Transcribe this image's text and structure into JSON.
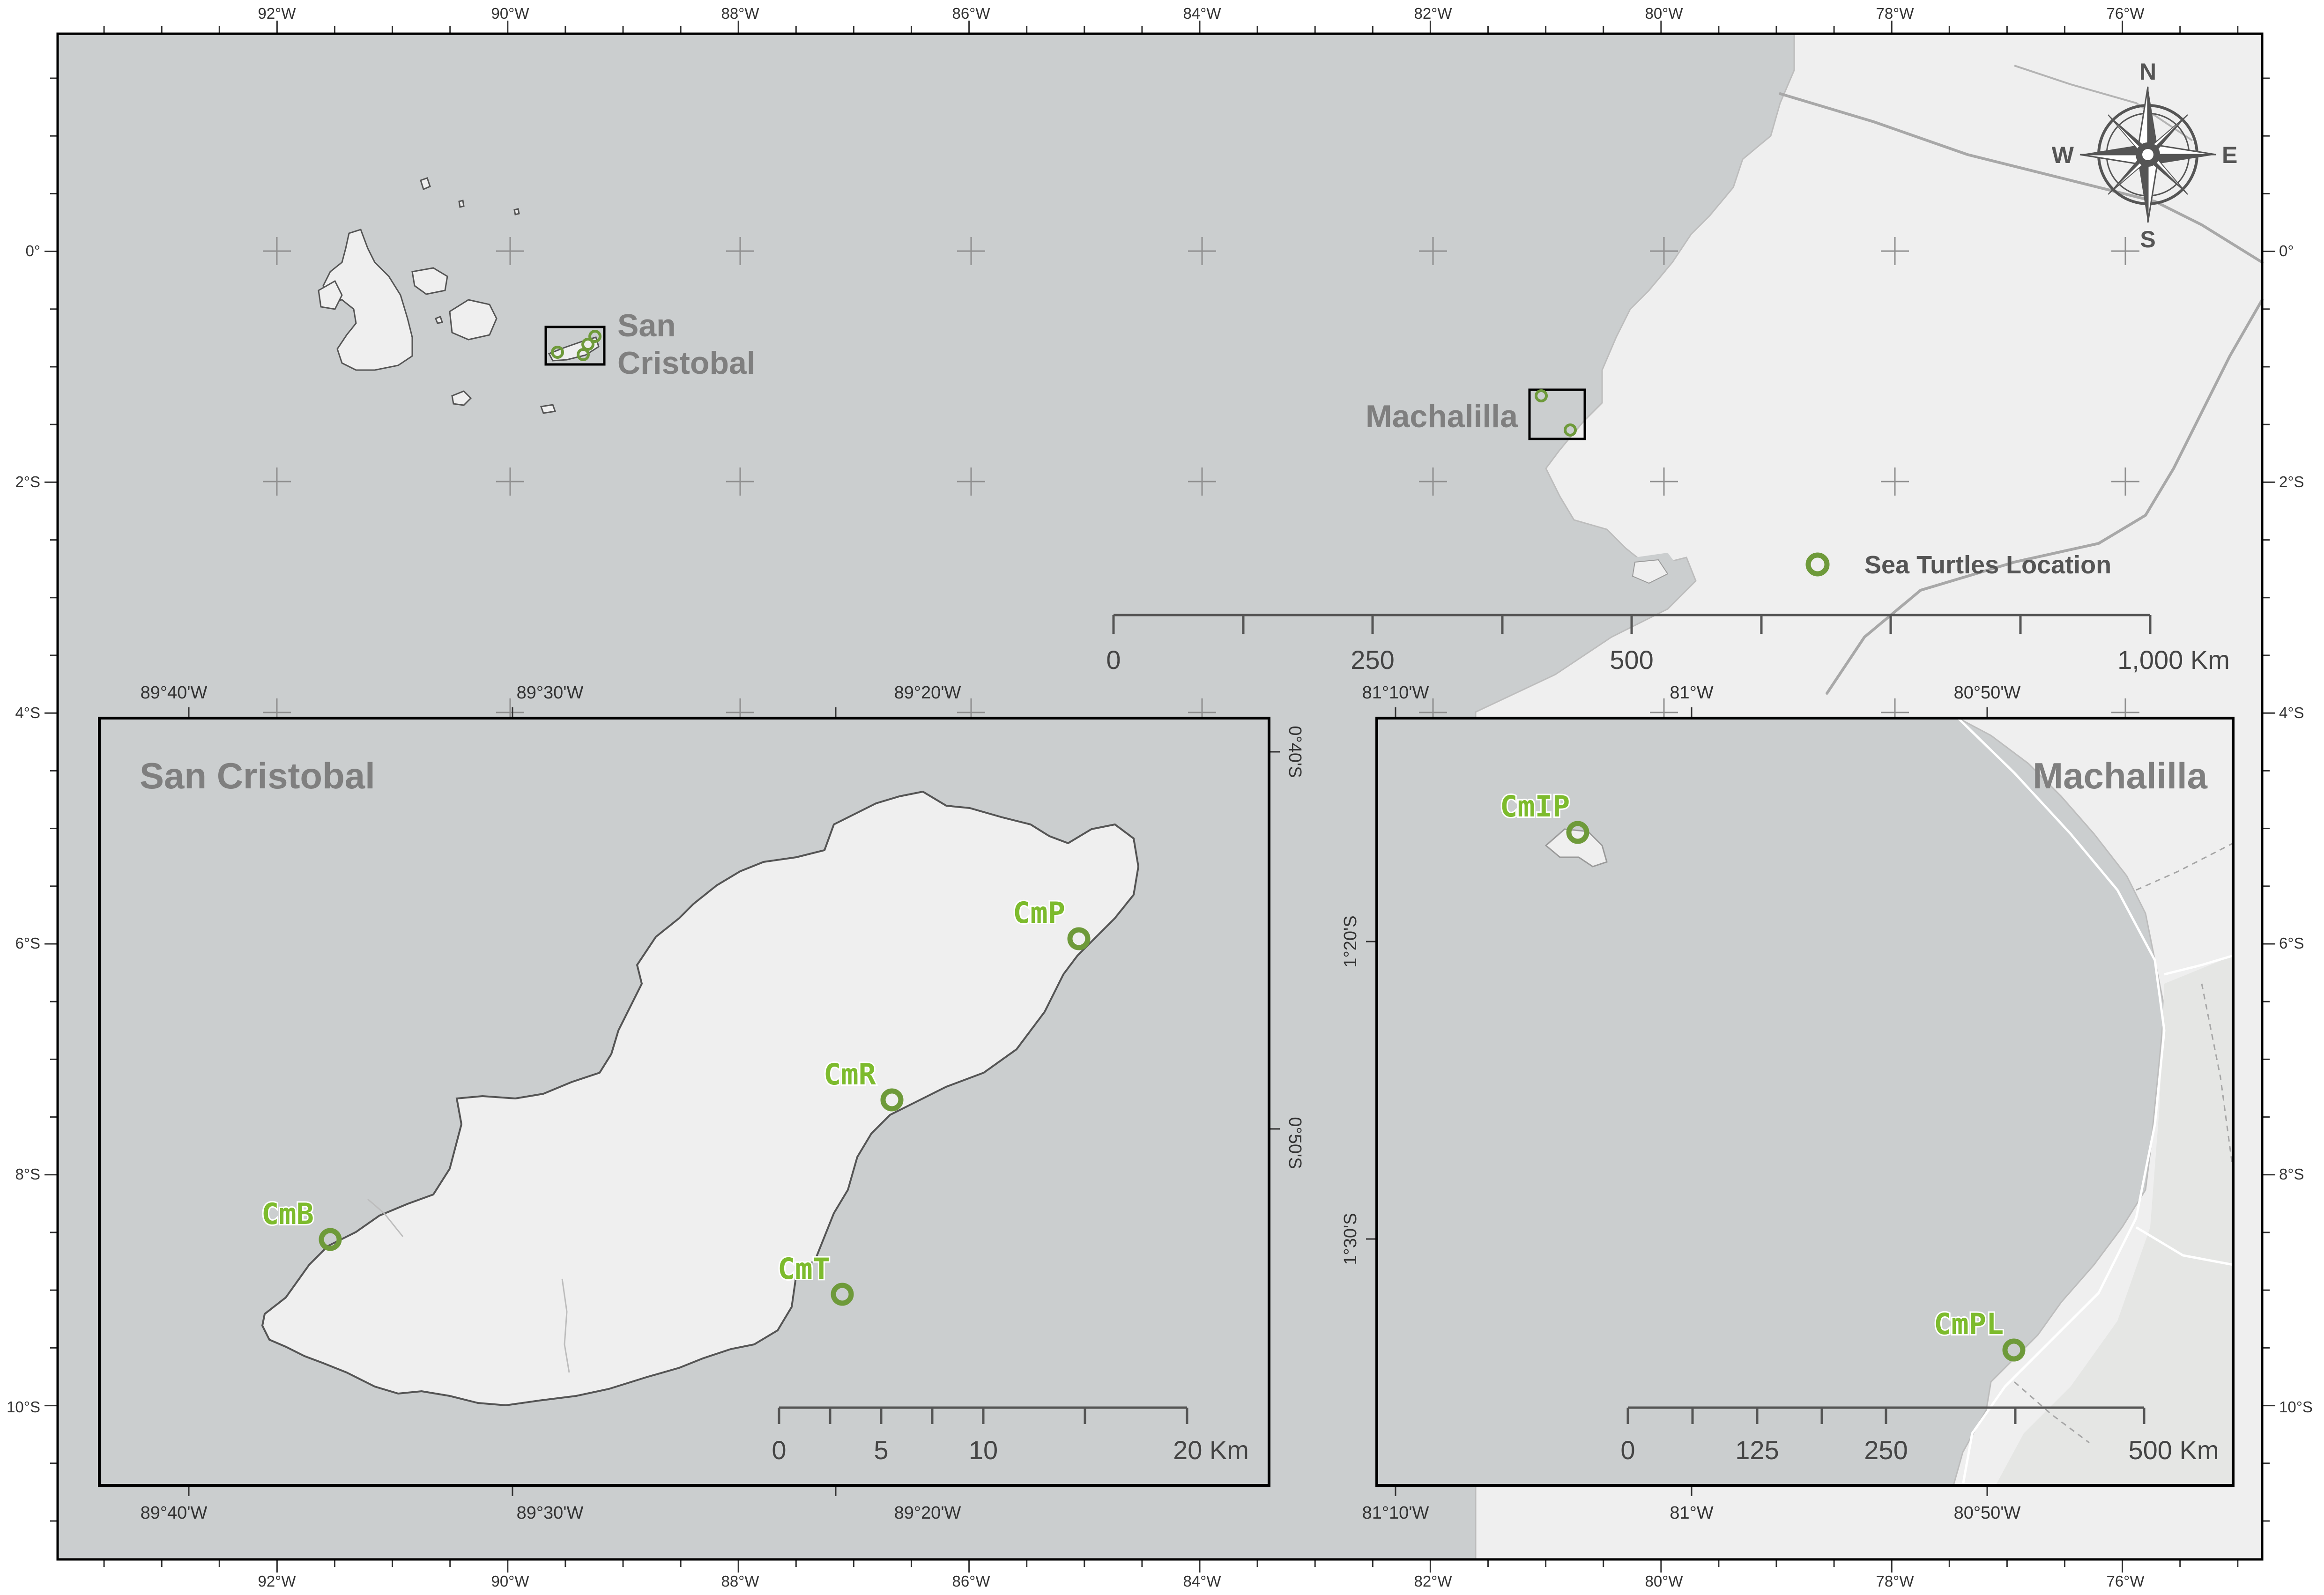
{
  "main_map": {
    "top_lon_labels": [
      "92°W",
      "90°W",
      "88°W",
      "86°W",
      "84°W",
      "82°W",
      "80°W",
      "78°W",
      "76°W"
    ],
    "bottom_lon_labels": [
      "92°W",
      "90°W",
      "88°W",
      "86°W",
      "84°W",
      "82°W",
      "80°W",
      "78°W",
      "76°W"
    ],
    "left_lat_labels": [
      "0°",
      "2°S",
      "4°S",
      "6°S",
      "8°S",
      "10°S"
    ],
    "right_lat_labels": [
      "0°",
      "2°S",
      "4°S",
      "6°S",
      "8°S",
      "10°S"
    ],
    "label_san_cristobal_line1": "San",
    "label_san_cristobal_line2": "Cristobal",
    "label_machalilla": "Machalilla",
    "legend_label": "Sea Turtles Location",
    "scale_labels": [
      "0",
      "250",
      "500",
      "1,000 Km"
    ],
    "compass": {
      "n": "N",
      "s": "S",
      "e": "E",
      "w": "W"
    }
  },
  "inset_san_cristobal": {
    "title": "San Cristobal",
    "top_lon_labels": [
      "89°40'W",
      "89°30'W",
      "89°20'W"
    ],
    "bottom_lon_labels": [
      "89°40'W",
      "89°30'W",
      "89°20'W"
    ],
    "right_lat_labels": [
      "0°40'S",
      "0°50'S"
    ],
    "sites": [
      "CmP",
      "CmR",
      "CmB",
      "CmT"
    ],
    "scale_labels": [
      "0",
      "5",
      "10",
      "20 Km"
    ]
  },
  "inset_machalilla": {
    "title": "Machalilla",
    "top_lon_labels": [
      "81°10'W",
      "81°W",
      "80°50'W"
    ],
    "bottom_lon_labels": [
      "81°10'W",
      "81°W",
      "80°50'W"
    ],
    "left_lat_labels": [
      "1°20'S",
      "1°30'S"
    ],
    "sites": [
      "CmIP",
      "CmPL"
    ],
    "scale_labels": [
      "0",
      "125",
      "250",
      "500 Km"
    ]
  },
  "colors": {
    "ocean": "#cbcecf",
    "land": "#efefef",
    "coast": "#555555",
    "marker": "#6e9a3a",
    "site_label": "#7dbb2d",
    "road": "#b9b9b9"
  }
}
